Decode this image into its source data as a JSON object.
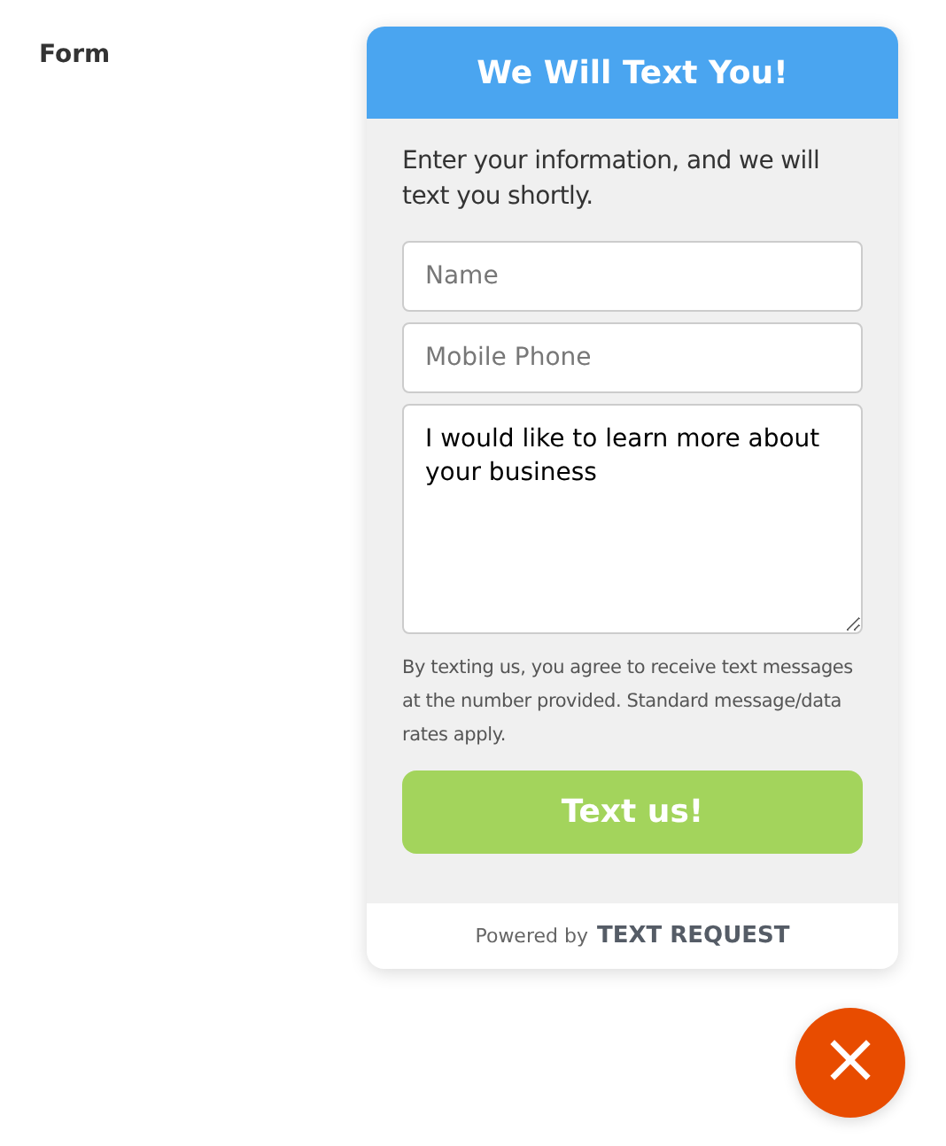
{
  "page_label": "Form",
  "widget": {
    "title": "We Will Text You!",
    "intro": "Enter your information, and we will text you shortly.",
    "fields": [
      {
        "kind": "input",
        "placeholder": "Name"
      },
      {
        "kind": "input",
        "placeholder": "Mobile Phone"
      },
      {
        "kind": "textarea",
        "value": "I would like to learn more about your business"
      }
    ],
    "disclaimer": "By texting us, you agree to receive text messages at the number provided. Standard message/data rates apply.",
    "submit": "Text us!",
    "footer": {
      "powered_by": "Powered by",
      "brand": "TEXT REQUEST"
    }
  },
  "close_button": {
    "label": "×"
  }
}
